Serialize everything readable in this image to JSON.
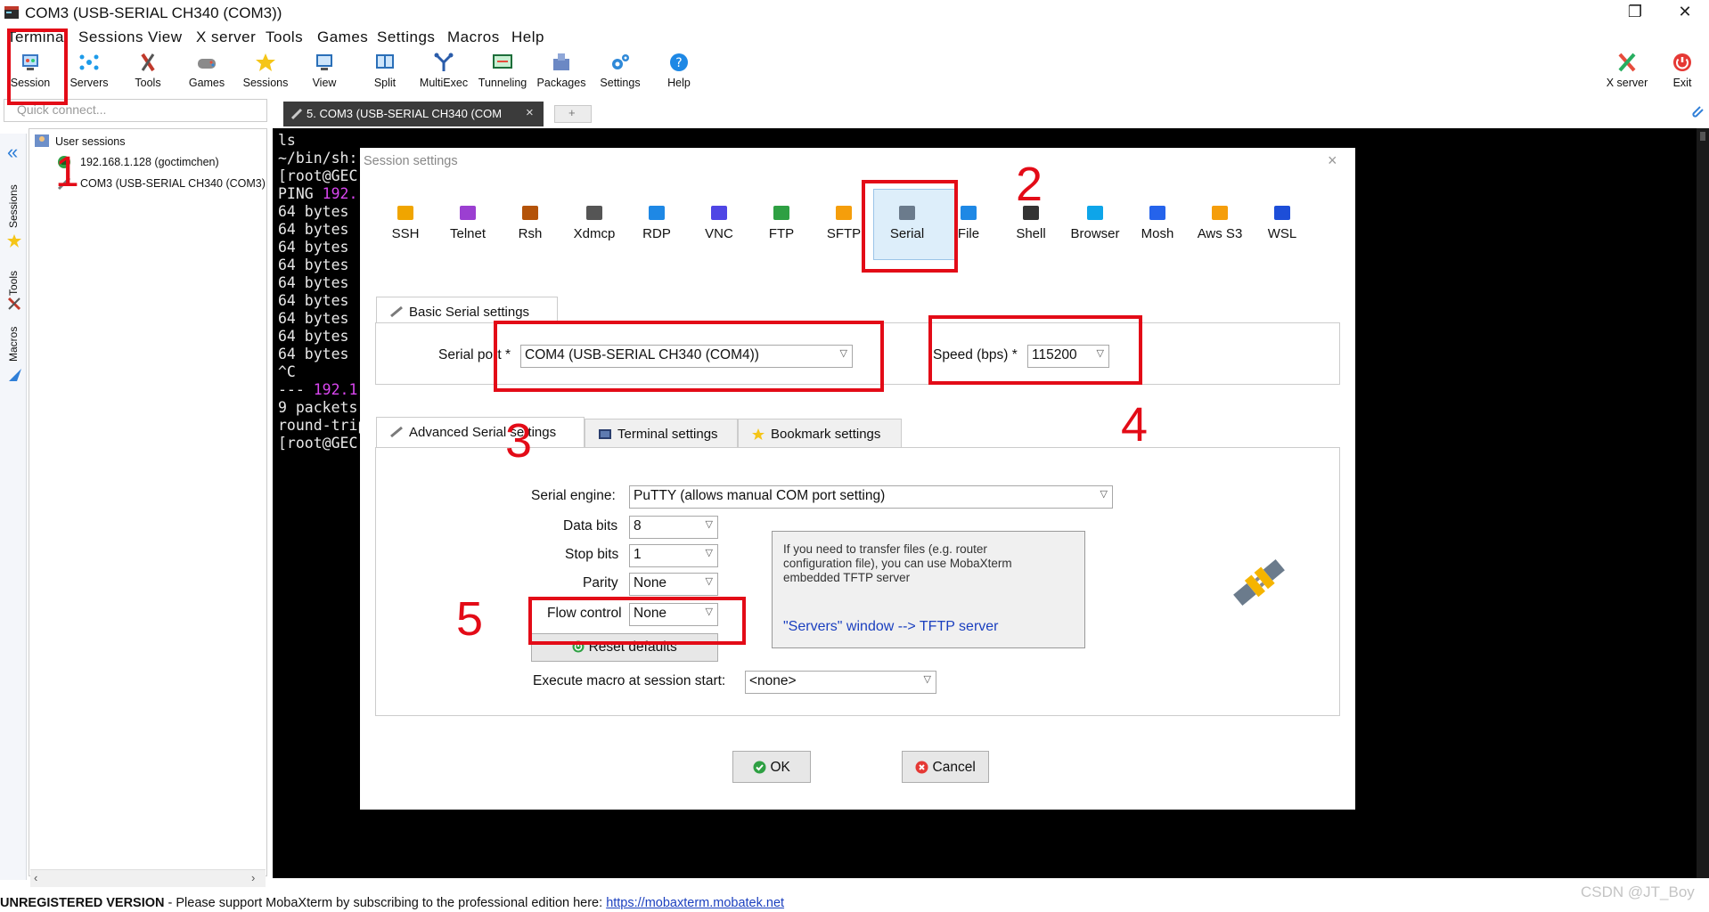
{
  "window": {
    "title": "COM3  (USB-SERIAL CH340 (COM3))",
    "restore_glyph": "❐",
    "close_glyph": "✕"
  },
  "menu": [
    "Terminal",
    "Sessions",
    "View",
    "X server",
    "Tools",
    "Games",
    "Settings",
    "Macros",
    "Help"
  ],
  "toolbar": {
    "buttons": [
      {
        "label": "Session",
        "icon": "session-icon"
      },
      {
        "label": "Servers",
        "icon": "servers-icon"
      },
      {
        "label": "Tools",
        "icon": "tools-icon"
      },
      {
        "label": "Games",
        "icon": "games-icon"
      },
      {
        "label": "Sessions",
        "icon": "star-icon"
      },
      {
        "label": "View",
        "icon": "view-icon"
      },
      {
        "label": "Split",
        "icon": "split-icon"
      },
      {
        "label": "MultiExec",
        "icon": "multiexec-icon"
      },
      {
        "label": "Tunneling",
        "icon": "tunneling-icon"
      },
      {
        "label": "Packages",
        "icon": "packages-icon"
      },
      {
        "label": "Settings",
        "icon": "settings-icon"
      },
      {
        "label": "Help",
        "icon": "help-icon"
      }
    ],
    "xserver_label": "X server",
    "exit_label": "Exit"
  },
  "quick_connect": {
    "placeholder": "Quick connect..."
  },
  "tabs": {
    "active": "5. COM3  (USB-SERIAL CH340 (COM",
    "close_glyph": "×",
    "new_glyph": "+"
  },
  "sidebar": {
    "labels": [
      "Sessions",
      "Tools",
      "Macros"
    ],
    "collapse_glyph": "«"
  },
  "tree": {
    "root": "User sessions",
    "items": [
      "192.168.1.128 (goctimchen)",
      "COM3  (USB-SERIAL CH340 (COM3))"
    ]
  },
  "terminal": {
    "lines": [
      {
        "text": "ls",
        "color": "#e8e8e8"
      },
      {
        "text": "~/bin/sh: ",
        "color": "#e8e8e8"
      },
      {
        "text": "[root@GEC",
        "color": "#e8e8e8"
      },
      {
        "text": "PING 192.",
        "color": "#e8e8e8",
        "accent": "192."
      },
      {
        "text": "64 bytes ",
        "color": "#e8e8e8"
      },
      {
        "text": "64 bytes ",
        "color": "#e8e8e8"
      },
      {
        "text": "64 bytes ",
        "color": "#e8e8e8"
      },
      {
        "text": "64 bytes ",
        "color": "#e8e8e8"
      },
      {
        "text": "64 bytes ",
        "color": "#e8e8e8"
      },
      {
        "text": "64 bytes ",
        "color": "#e8e8e8"
      },
      {
        "text": "64 bytes ",
        "color": "#e8e8e8"
      },
      {
        "text": "64 bytes ",
        "color": "#e8e8e8"
      },
      {
        "text": "64 bytes ",
        "color": "#e8e8e8"
      },
      {
        "text": "^C",
        "color": "#e8e8e8"
      },
      {
        "text": "--- 192.1",
        "color": "#e8e8e8",
        "accent": "192.1"
      },
      {
        "text": "9 packets",
        "color": "#e8e8e8"
      },
      {
        "text": "round-trip",
        "color": "#e8e8e8"
      },
      {
        "text": "[root@GEC",
        "color": "#e8e8e8"
      }
    ],
    "accent_color": "#d946ef"
  },
  "dialog": {
    "title": "Session settings",
    "close_glyph": "×",
    "session_types": [
      {
        "label": "SSH",
        "icon": "ssh-icon"
      },
      {
        "label": "Telnet",
        "icon": "telnet-icon"
      },
      {
        "label": "Rsh",
        "icon": "rsh-icon"
      },
      {
        "label": "Xdmcp",
        "icon": "xdmcp-icon"
      },
      {
        "label": "RDP",
        "icon": "rdp-icon"
      },
      {
        "label": "VNC",
        "icon": "vnc-icon"
      },
      {
        "label": "FTP",
        "icon": "ftp-icon"
      },
      {
        "label": "SFTP",
        "icon": "sftp-icon"
      },
      {
        "label": "Serial",
        "icon": "serial-icon"
      },
      {
        "label": "File",
        "icon": "file-icon"
      },
      {
        "label": "Shell",
        "icon": "shell-icon"
      },
      {
        "label": "Browser",
        "icon": "browser-icon"
      },
      {
        "label": "Mosh",
        "icon": "mosh-icon"
      },
      {
        "label": "Aws S3",
        "icon": "aws-icon"
      },
      {
        "label": "WSL",
        "icon": "wsl-icon"
      }
    ],
    "basic_tab": "Basic Serial settings",
    "serial_port_label": "Serial port *",
    "serial_port_value": "COM4  (USB-SERIAL CH340 (COM4))",
    "speed_label": "Speed (bps) *",
    "speed_value": "115200",
    "adv_tabs": [
      "Advanced Serial settings",
      "Terminal settings",
      "Bookmark settings"
    ],
    "serial_engine_label": "Serial engine:",
    "serial_engine_value": "PuTTY    (allows manual COM port setting)",
    "data_bits_label": "Data bits",
    "data_bits_value": "8",
    "stop_bits_label": "Stop bits",
    "stop_bits_value": "1",
    "parity_label": "Parity",
    "parity_value": "None",
    "flow_control_label": "Flow control",
    "flow_control_value": "None",
    "reset_label": "Reset defaults",
    "info_text": "If you need to transfer files (e.g. router configuration file), you can use MobaXterm embedded TFTP server",
    "info_link": "\"Servers\" window  -->  TFTP server",
    "macro_label": "Execute macro at session start:",
    "macro_value": "<none>",
    "ok_label": "OK",
    "cancel_label": "Cancel"
  },
  "annotations": [
    "1",
    "2",
    "3",
    "4",
    "5"
  ],
  "status": {
    "unregistered": "UNREGISTERED VERSION",
    "support_text": "  -  Please support MobaXterm by subscribing to the professional edition here: ",
    "link": "https://mobaxterm.mobatek.net"
  },
  "watermark": "CSDN @JT_Boy",
  "colors": {
    "annotation_red": "#e30b17",
    "terminal_bg": "#000000",
    "selected_tab": "#ddeefa",
    "link_blue": "#1a3fbf"
  }
}
